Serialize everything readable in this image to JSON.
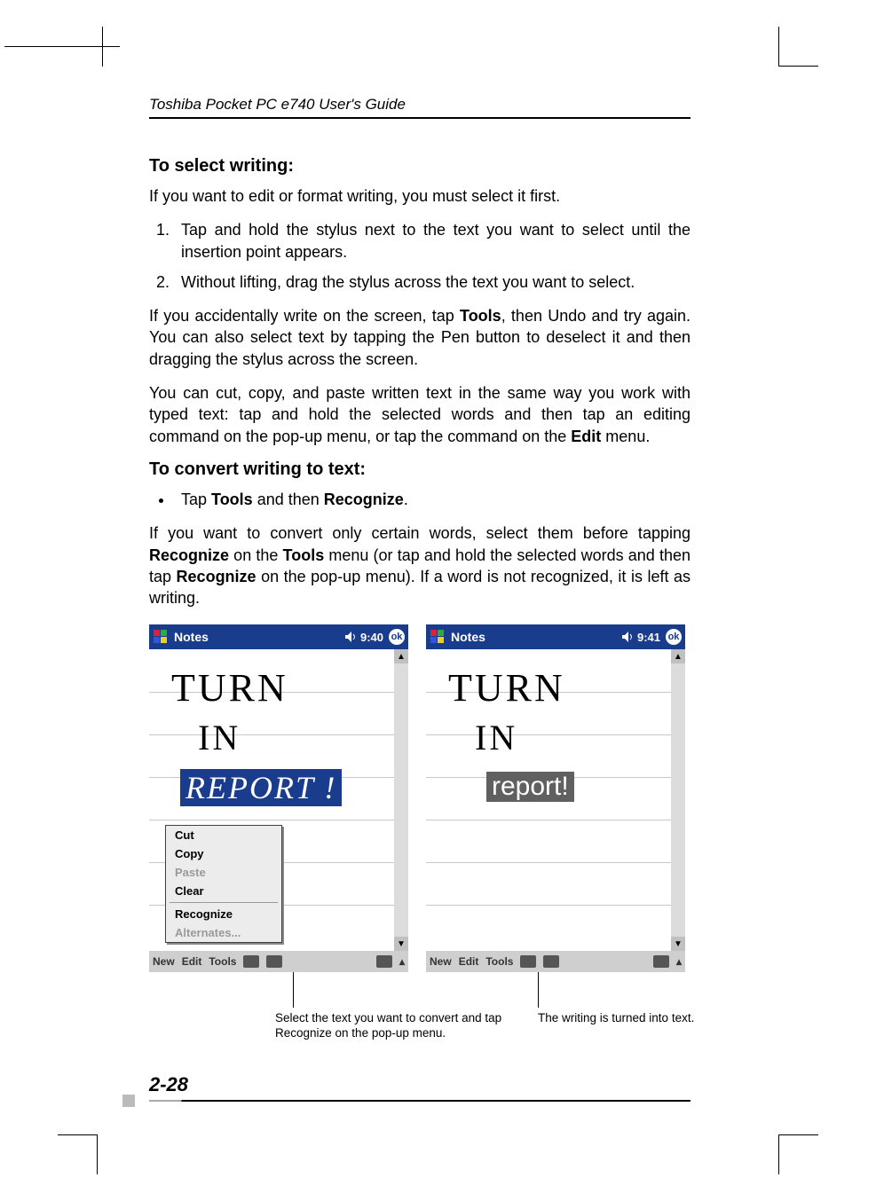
{
  "header": {
    "running_head": "Toshiba Pocket PC e740  User's Guide"
  },
  "sections": {
    "select_writing": {
      "title": "To select writing:",
      "intro": "If you want to edit or format writing, you must select it first.",
      "steps": [
        "Tap and hold the stylus next to the text you want to select until the insertion point appears.",
        "Without lifting, drag the stylus across the text you want to select."
      ],
      "para_undo_pre": "If you accidentally write on the screen, tap ",
      "para_undo_bold": "Tools",
      "para_undo_post": ", then Undo and try again. You can also select text by tapping the Pen button to deselect it and then dragging the stylus across the screen.",
      "para_cut_pre": "You can cut, copy, and paste written text in the same way you work with typed text: tap and hold the selected words and then tap an editing command on the pop-up menu, or tap the command on the ",
      "para_cut_bold": "Edit",
      "para_cut_post": " menu."
    },
    "convert_writing": {
      "title": "To convert writing to text:",
      "bullet_pre": "Tap ",
      "bullet_b1": "Tools",
      "bullet_mid": " and then ",
      "bullet_b2": "Recognize",
      "bullet_post": ".",
      "para_pre": "If you want to convert only certain words, select them before tapping  ",
      "para_b1": "Recognize",
      "para_mid1": "  on the  ",
      "para_b2": "Tools",
      "para_mid2": "  menu (or tap and hold the selected words and then tap ",
      "para_b3": "Recognize",
      "para_post": " on the pop-up menu). If a word is not recognized, it is left as writing."
    }
  },
  "screenshots": {
    "left": {
      "app_title": "Notes",
      "time": "9:40",
      "ok": "ok",
      "hand_line1": "TURN",
      "hand_line2": "IN",
      "hand_selected": "REPORT !",
      "context_menu": {
        "cut": "Cut",
        "copy": "Copy",
        "paste": "Paste",
        "clear": "Clear",
        "recognize": "Recognize",
        "alternates": "Alternates..."
      },
      "bottom": {
        "new": "New",
        "edit": "Edit",
        "tools": "Tools"
      }
    },
    "right": {
      "app_title": "Notes",
      "time": "9:41",
      "ok": "ok",
      "hand_line1": "TURN",
      "hand_line2": "IN",
      "converted": "report!",
      "bottom": {
        "new": "New",
        "edit": "Edit",
        "tools": "Tools"
      }
    }
  },
  "callouts": {
    "left": "Select the text you want to convert and tap Recognize on the pop-up menu.",
    "right": "The writing is turned into text."
  },
  "footer": {
    "page_number": "2-28"
  }
}
